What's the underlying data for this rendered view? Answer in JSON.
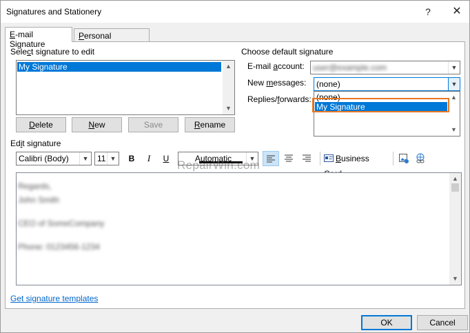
{
  "window": {
    "title": "Signatures and Stationery",
    "help": "?",
    "close": "✕"
  },
  "tabs": [
    {
      "prefix": "",
      "accel": "E",
      "rest": "-mail Signature",
      "active": true
    },
    {
      "prefix": "",
      "accel": "P",
      "rest": "ersonal Stationery",
      "active": false
    }
  ],
  "select_section": {
    "pre": "Sele",
    "accel": "c",
    "post": "t signature to edit"
  },
  "signature_list": [
    "My Signature"
  ],
  "buttons": {
    "delete": {
      "accel": "D",
      "rest": "elete"
    },
    "new": {
      "accel": "N",
      "rest": "ew"
    },
    "save": "Save",
    "rename": {
      "accel": "R",
      "rest": "ename"
    }
  },
  "defaults": {
    "heading": "Choose default signature",
    "email_account_label": {
      "pre": "E-mail ",
      "accel": "a",
      "post": "ccount:"
    },
    "email_account_value": "user@example.com",
    "new_messages_label": {
      "pre": "New ",
      "accel": "m",
      "post": "essages:"
    },
    "new_messages_value": "(none)",
    "replies_label": {
      "pre": "Replies/",
      "accel": "f",
      "post": "orwards:"
    },
    "dropdown_options": [
      "(none)",
      "My Signature"
    ]
  },
  "edit_section": {
    "pre": "Ed",
    "accel": "i",
    "post": "t signature"
  },
  "toolbar": {
    "font": "Calibri (Body)",
    "size": "11",
    "bold": "B",
    "italic": "I",
    "underline": "U",
    "color": "Automatic",
    "business_card": {
      "accel": "B",
      "rest": "usiness Card"
    }
  },
  "signature_body": [
    "Regards,",
    "John Smith",
    "",
    "CEO of SomeCompany",
    "",
    "Phone: 0123456-1234"
  ],
  "watermark": "RepairWin.com",
  "link": "Get signature templates",
  "ok": "OK",
  "cancel": "Cancel"
}
